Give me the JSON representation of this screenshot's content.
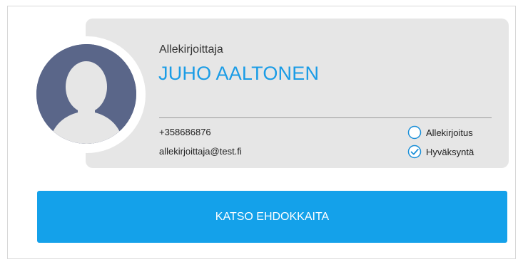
{
  "signer": {
    "role_label": "Allekirjoittaja",
    "name": "JUHO AALTONEN",
    "phone": "+358686876",
    "email": "allekirjoittaja@test.fi",
    "avatar_icon": "person-silhouette-icon"
  },
  "options": [
    {
      "label": "Allekirjoitus",
      "checked": false,
      "icon": "empty-circle-icon"
    },
    {
      "label": "Hyväksyntä",
      "checked": true,
      "icon": "checked-circle-icon"
    }
  ],
  "action": {
    "label": "KATSO EHDOKKAITA"
  },
  "colors": {
    "accent": "#1a9ce6",
    "button": "#14a1ea",
    "card_bg": "#e6e6e6",
    "avatar_bg": "#5a6689"
  }
}
